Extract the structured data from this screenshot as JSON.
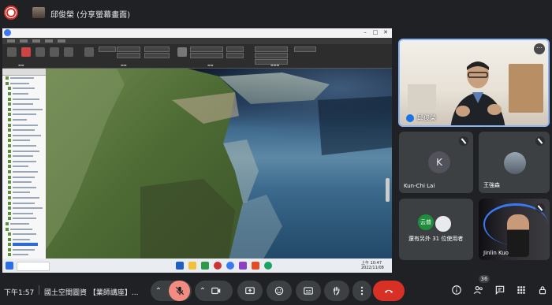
{
  "meeting": {
    "presenter_title": "邱俊榮 (分享螢幕畫面)",
    "time": "下午1:57",
    "title": "國土空間圖資 【業師講座】...",
    "participant_count": "36"
  },
  "participants": {
    "tile1_name": "邱俊榮",
    "tile2_initial": "K",
    "tile2_name": "Kun-Chi Lai",
    "tile3_name": "王強森",
    "tile4_text": "還有另外 31 位使用者",
    "tile4_avatar_a": "云普",
    "tile5_name": "Jinlin Kuo"
  },
  "shared_screen": {
    "app_path": "C:\\SkylineGlobe\\SkylineGlobe\\Tools\\20221023_0311",
    "taskbar_time": "上午 10:47",
    "taskbar_date": "2022/11/08"
  },
  "colors": {
    "accent": "#8ab4f8",
    "leave": "#d93025",
    "mic_off": "#f28b82",
    "record": "#d93025"
  },
  "icons": [
    "record-icon",
    "mic-off-icon",
    "camera-icon",
    "present-icon",
    "emoji-icon",
    "captions-icon",
    "raise-hand-icon",
    "more-icon",
    "leave-call-icon",
    "info-icon",
    "people-icon",
    "chat-icon",
    "activities-icon",
    "lock-icon"
  ]
}
